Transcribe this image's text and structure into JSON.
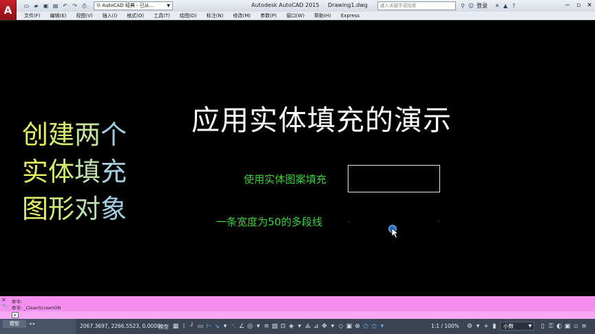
{
  "app": {
    "logo_letter": "A",
    "workspace": "AutoCAD 经典 - 已从...",
    "product": "Autodesk AutoCAD 2015",
    "document": "Drawing1.dwg",
    "search_placeholder": "键入关键字或短语",
    "login": "登录"
  },
  "menu": [
    "文件(F)",
    "编辑(E)",
    "视图(V)",
    "插入(I)",
    "格式(O)",
    "工具(T)",
    "绘图(D)",
    "标注(N)",
    "修改(M)",
    "参数(P)",
    "窗口(W)",
    "帮助(H)",
    "Express"
  ],
  "canvas": {
    "title": "应用实体填充的演示",
    "side_lines": [
      [
        "创",
        "建",
        "两",
        "个"
      ],
      [
        "实",
        "体",
        "填",
        "充"
      ],
      [
        "图",
        "形",
        "对",
        "象"
      ]
    ],
    "label_hatch": "使用实体图案填充",
    "label_pline": "一条宽度为50的多段线"
  },
  "command": {
    "history": [
      "命令:",
      "命令: _CleanScreenON"
    ],
    "input_placeholder": ""
  },
  "status": {
    "tab_model": "模型",
    "coords": "2067.3697, 2266.5523, 0.0000",
    "space": "模型",
    "scale": "1:1 / 100%",
    "units": "小数"
  },
  "colors": {
    "canvas_bg": "#000000",
    "label_green": "#3ed13e",
    "command_bg": "#f48ff0",
    "statusbar_bg": "#3b4453"
  }
}
